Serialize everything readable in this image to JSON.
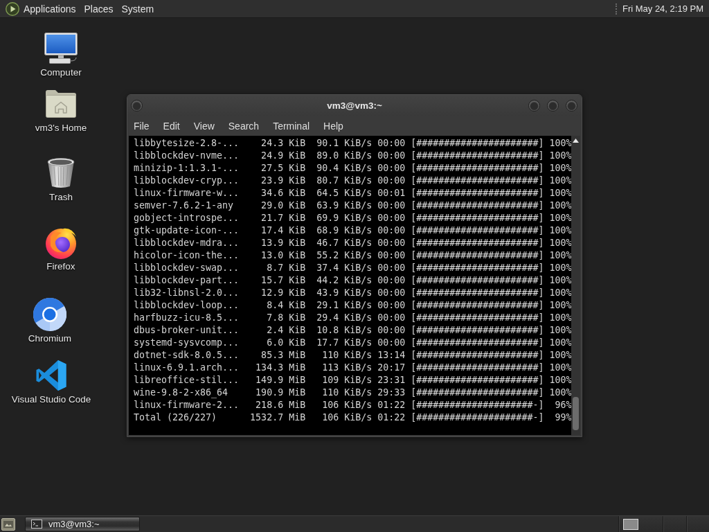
{
  "top_panel": {
    "menus": [
      "Applications",
      "Places",
      "System"
    ],
    "clock": "Fri May 24, 2:19 PM"
  },
  "desktop_icons": [
    {
      "label": "Computer",
      "kind": "computer"
    },
    {
      "label": "vm3's Home",
      "kind": "home"
    },
    {
      "label": "Trash",
      "kind": "trash"
    },
    {
      "label": "Firefox",
      "kind": "firefox"
    },
    {
      "label": "Chromium",
      "kind": "chromium"
    },
    {
      "label": "Visual Studio Code",
      "kind": "vscode"
    }
  ],
  "terminal_window": {
    "title": "vm3@vm3:~",
    "menu": [
      "File",
      "Edit",
      "View",
      "Search",
      "Terminal",
      "Help"
    ],
    "lines": [
      "libbytesize-2.8-...    24.3 KiB  90.1 KiB/s 00:00 [######################] 100%",
      "libblockdev-nvme...    24.9 KiB  89.0 KiB/s 00:00 [######################] 100%",
      "minizip-1:1.3.1-...    27.5 KiB  90.4 KiB/s 00:00 [######################] 100%",
      "libblockdev-cryp...    23.9 KiB  80.7 KiB/s 00:00 [######################] 100%",
      "linux-firmware-w...    34.6 KiB  64.5 KiB/s 00:01 [######################] 100%",
      "semver-7.6.2-1-any     29.0 KiB  63.9 KiB/s 00:00 [######################] 100%",
      "gobject-introspe...    21.7 KiB  69.9 KiB/s 00:00 [######################] 100%",
      "gtk-update-icon-...    17.4 KiB  68.9 KiB/s 00:00 [######################] 100%",
      "libblockdev-mdra...    13.9 KiB  46.7 KiB/s 00:00 [######################] 100%",
      "hicolor-icon-the...    13.0 KiB  55.2 KiB/s 00:00 [######################] 100%",
      "libblockdev-swap...     8.7 KiB  37.4 KiB/s 00:00 [######################] 100%",
      "libblockdev-part...    15.7 KiB  44.2 KiB/s 00:00 [######################] 100%",
      "lib32-libnsl-2.0...    12.9 KiB  43.9 KiB/s 00:00 [######################] 100%",
      "libblockdev-loop...     8.4 KiB  29.1 KiB/s 00:00 [######################] 100%",
      "harfbuzz-icu-8.5...     7.8 KiB  29.4 KiB/s 00:00 [######################] 100%",
      "dbus-broker-unit...     2.4 KiB  10.8 KiB/s 00:00 [######################] 100%",
      "systemd-sysvcomp...     6.0 KiB  17.7 KiB/s 00:00 [######################] 100%",
      "dotnet-sdk-8.0.5...    85.3 MiB   110 KiB/s 13:14 [######################] 100%",
      "linux-6.9.1.arch...   134.3 MiB   113 KiB/s 20:17 [######################] 100%",
      "libreoffice-stil...   149.9 MiB   109 KiB/s 23:31 [######################] 100%",
      "wine-9.8-2-x86_64     190.9 MiB   110 KiB/s 29:33 [######################] 100%",
      "linux-firmware-2...   218.6 MiB   106 KiB/s 01:22 [#####################-]  96%",
      "Total (226/227)      1532.7 MiB   106 KiB/s 01:22 [#####################-]  99%"
    ]
  },
  "taskbar": {
    "windows": [
      {
        "label": "vm3@vm3:~",
        "selected": true
      }
    ]
  }
}
